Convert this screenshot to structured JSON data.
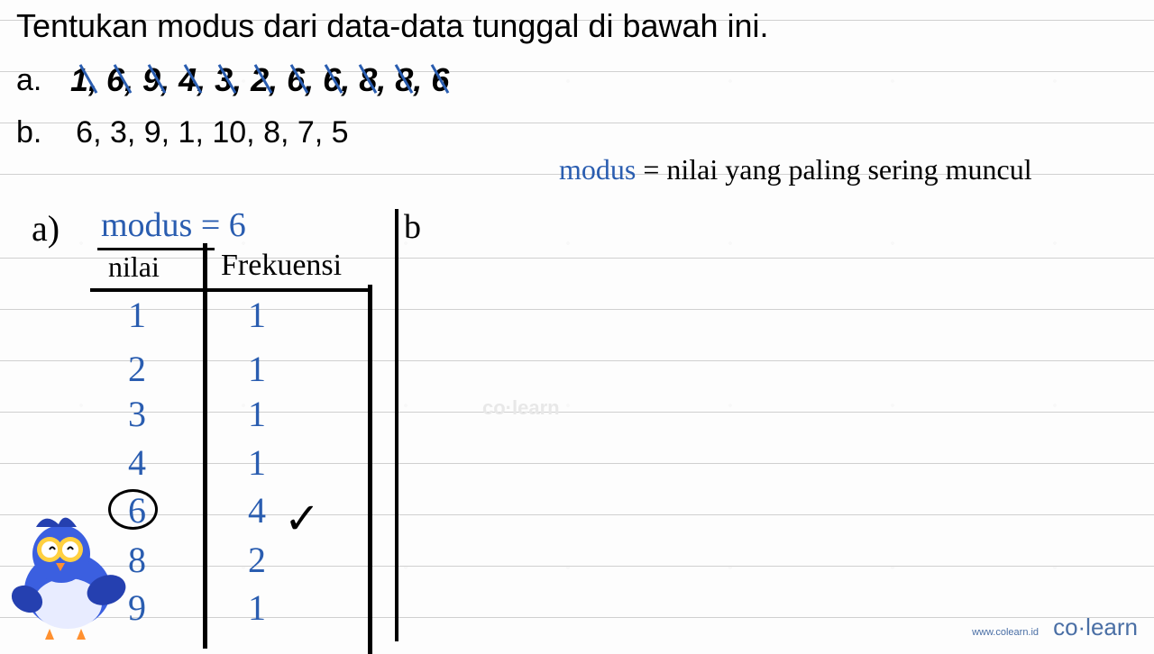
{
  "question": {
    "title": "Tentukan modus dari data-data tunggal di bawah ini.",
    "items": {
      "a_label": "a.",
      "a_data": "1, 6, 9, 4, 3, 2, 6, 6, 8, 8, 6",
      "b_label": "b.",
      "b_data": "6, 3, 9, 1, 10, 8, 7, 5"
    }
  },
  "annotation": {
    "definition_prefix": "modus",
    "definition_eq": " = ",
    "definition_text": "nilai yang paling sering muncul",
    "part_a": "a)",
    "part_b": "b",
    "modus_result_label": "modus = ",
    "modus_result_value": "6"
  },
  "table": {
    "header_nilai": "nilai",
    "header_freq": "Frekuensi",
    "rows": [
      {
        "nilai": "1",
        "freq": "1"
      },
      {
        "nilai": "2",
        "freq": "1"
      },
      {
        "nilai": "3",
        "freq": "1"
      },
      {
        "nilai": "4",
        "freq": "1"
      },
      {
        "nilai": "6",
        "freq": "4"
      },
      {
        "nilai": "8",
        "freq": "2"
      },
      {
        "nilai": "9",
        "freq": "1"
      }
    ],
    "check": "✓"
  },
  "footer": {
    "url": "www.colearn.id",
    "brand": "co·learn"
  },
  "watermark": "co·learn"
}
